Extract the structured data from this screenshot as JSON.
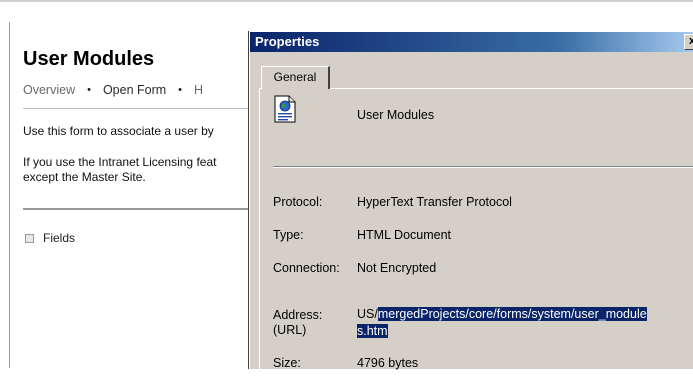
{
  "background_page": {
    "title": "User Modules",
    "nav": {
      "overview": "Overview",
      "separator": "•",
      "open_form": "Open Form",
      "truncated": "H"
    },
    "paragraph1": "Use this form to associate a user by",
    "paragraph2_line1": "If you use the Intranet Licensing feat",
    "paragraph2_line2": "except the Master Site.",
    "fields_label": "Fields"
  },
  "dialog": {
    "title": "Properties",
    "close_glyph": "x",
    "tab_general": "General",
    "icon": "html-document-icon",
    "name": "User Modules",
    "protocol_label": "Protocol:",
    "protocol_value": "HyperText Transfer Protocol",
    "type_label": "Type:",
    "type_value": "HTML Document",
    "connection_label": "Connection:",
    "connection_value": "Not Encrypted",
    "address_label_line1": "Address:",
    "address_label_line2": "(URL)",
    "address_prefix": "US/",
    "address_selected_line1": "mergedProjects/core/forms/system/user_module",
    "address_selected_line2": "s.htm",
    "size_label": "Size:",
    "size_value": "4796 bytes"
  },
  "colors": {
    "titlebar_start": "#0a246a",
    "dialog_face": "#d4d0c8",
    "selection": "#0a246a"
  }
}
